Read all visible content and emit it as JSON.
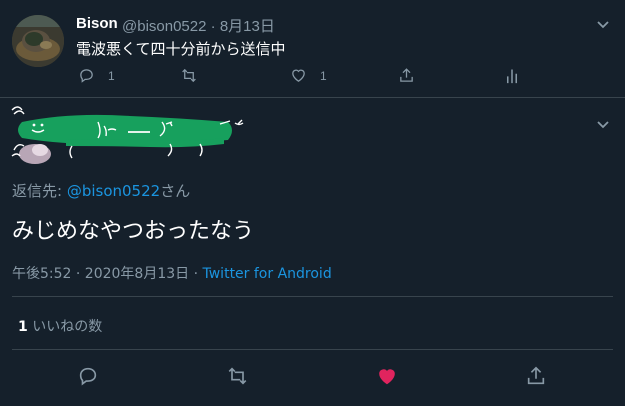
{
  "tweet1": {
    "display_name": "Bison",
    "handle": "@bison0522",
    "separator": "·",
    "date": "8月13日",
    "text": "電波悪くて四十分前から送信中",
    "actions": {
      "reply_count": "1",
      "like_count": "1"
    }
  },
  "tweet2": {
    "reply_prefix": "返信先: ",
    "reply_handle": "@bison0522",
    "reply_suffix": "さん",
    "text": "みじめなやつおったなう",
    "timestamp": "午後5:52 · 2020年8月13日 · ",
    "source": "Twitter for Android",
    "likes_count": "1",
    "likes_label": " いいねの数"
  },
  "colors": {
    "background": "#15202b",
    "muted": "#8899a6",
    "link": "#1b95e0",
    "like_active": "#e0245e",
    "redaction": "#17a05d"
  },
  "icons": [
    "reply-icon",
    "retweet-icon",
    "like-icon",
    "share-icon",
    "analytics-icon",
    "chevron-down-icon"
  ]
}
